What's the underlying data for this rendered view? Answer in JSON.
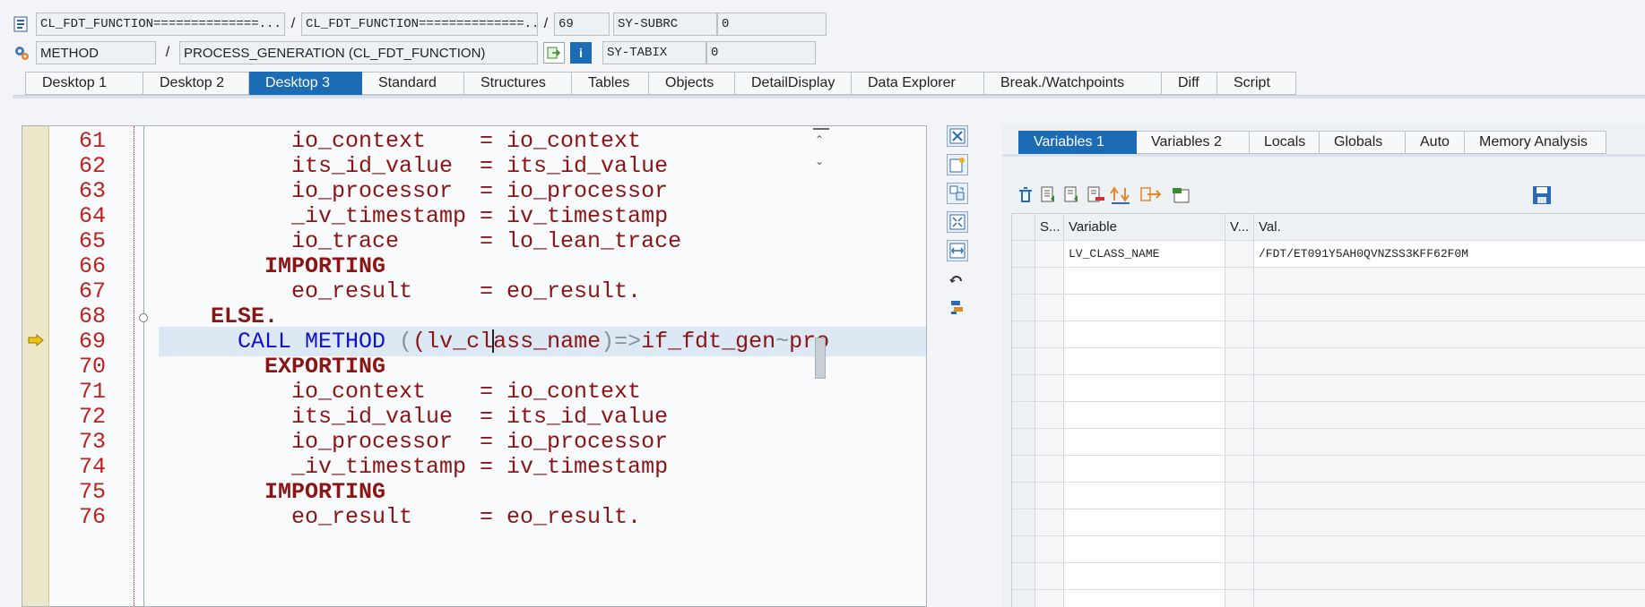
{
  "header": {
    "program": "CL_FDT_FUNCTION==============...",
    "include": "CL_FDT_FUNCTION==============...",
    "line": "69",
    "event_type": "METHOD",
    "event": "PROCESS_GENERATION (CL_FDT_FUNCTION)",
    "sysfields": [
      {
        "name": "SY-SUBRC",
        "value": "0"
      },
      {
        "name": "SY-TABIX",
        "value": "0"
      }
    ],
    "separator": "/"
  },
  "desktop_tabs": [
    "Desktop 1",
    "Desktop 2",
    "Desktop 3",
    "Standard",
    "Structures",
    "Tables",
    "Objects",
    "DetailDisplay",
    "Data Explorer",
    "Break./Watchpoints",
    "Diff",
    "Script"
  ],
  "active_desktop_tab": "Desktop 3",
  "code": {
    "current_line": "69",
    "lines": [
      {
        "num": "61",
        "text": "io_context    = io_context"
      },
      {
        "num": "62",
        "text": "its_id_value  = its_id_value"
      },
      {
        "num": "63",
        "text": "io_processor  = io_processor"
      },
      {
        "num": "64",
        "text": "_iv_timestamp = iv_timestamp"
      },
      {
        "num": "65",
        "text": "io_trace      = lo_lean_trace"
      },
      {
        "num": "66",
        "text": "IMPORTING"
      },
      {
        "num": "67",
        "text": "eo_result     = eo_result."
      },
      {
        "num": "68",
        "text": "ELSE."
      },
      {
        "num": "69",
        "kw1": "CALL METHOD",
        "pre_cursor": "(lv_cl",
        "post_cursor": "ass_name",
        "arrow": ")=>",
        "rest": "if_fdt_gen",
        "tilde": "~",
        "tail": "pro"
      },
      {
        "num": "70",
        "text": "EXPORTING"
      },
      {
        "num": "71",
        "text": "io_context    = io_context"
      },
      {
        "num": "72",
        "text": "its_id_value  = its_id_value"
      },
      {
        "num": "73",
        "text": "io_processor  = io_processor"
      },
      {
        "num": "74",
        "text": "_iv_timestamp = iv_timestamp"
      },
      {
        "num": "75",
        "text": "IMPORTING"
      },
      {
        "num": "76",
        "text": "eo_result     = eo_result."
      }
    ]
  },
  "variable_tabs": [
    "Variables 1",
    "Variables 2",
    "Locals",
    "Globals",
    "Auto",
    "Memory Analysis"
  ],
  "active_variable_tab": "Variables 1",
  "variables_table": {
    "headers": {
      "s": "S...",
      "variable": "Variable",
      "v": "V...",
      "value": "Val."
    },
    "rows": [
      {
        "variable": "LV_CLASS_NAME",
        "value": "/FDT/ET091Y5AH0QVNZSS3KFF62F0M"
      }
    ]
  },
  "colors": {
    "accent": "#1c6bb5",
    "line_number": "#c02020",
    "keyword": "#1010d0",
    "identifier": "#8b1414"
  }
}
